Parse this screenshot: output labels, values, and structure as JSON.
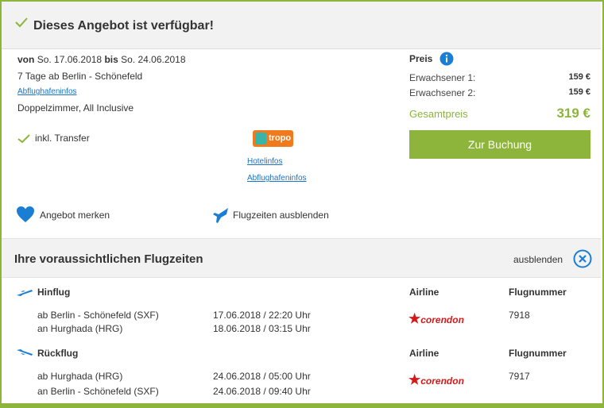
{
  "header": {
    "title": "Dieses Angebot ist verfügbar!"
  },
  "offer": {
    "von_label": "von",
    "date_from": "So. 17.06.2018",
    "bis_label": "bis",
    "date_to": "So. 24.06.2018",
    "duration": "7 Tage ab Berlin - Schönefeld",
    "airport_info_link": "Abflughafeninfos",
    "room": "Doppelzimmer, All Inclusive",
    "transfer": "inkl. Transfer",
    "provider_logo": "tropo",
    "hotel_info_link": "Hotelinfos",
    "airport_info_link_2": "Abflughafeninfos",
    "bookmark": "Angebot merken",
    "flight_toggle": "Flugzeiten ausblenden"
  },
  "price": {
    "label": "Preis",
    "adult1_label": "Erwachsener 1:",
    "adult1_value": "159 €",
    "adult2_label": "Erwachsener 2:",
    "adult2_value": "159 €",
    "total_label": "Gesamtpreis",
    "total_value": "319 €",
    "book_button": "Zur Buchung"
  },
  "flights": {
    "title": "Ihre voraussichtlichen Flugzeiten",
    "hide_label": "ausblenden",
    "outbound": {
      "label": "Hinflug",
      "airline_header": "Airline",
      "flightno_header": "Flugnummer",
      "dep_place": "ab Berlin - Schönefeld (SXF)",
      "dep_time": "17.06.2018 / 22:20 Uhr",
      "arr_place": "an Hurghada (HRG)",
      "arr_time": "18.06.2018 / 03:15 Uhr",
      "airline": "corendon",
      "flight_number": "7918"
    },
    "return": {
      "label": "Rückflug",
      "airline_header": "Airline",
      "flightno_header": "Flugnummer",
      "dep_place": "ab Hurghada (HRG)",
      "dep_time": "24.06.2018 / 05:00 Uhr",
      "arr_place": "an Berlin - Schönefeld (SXF)",
      "arr_time": "24.06.2018 / 09:40 Uhr",
      "airline": "corendon",
      "flight_number": "7917"
    }
  },
  "colors": {
    "accent": "#8db53c",
    "link": "#1a73c9",
    "icon_blue": "#1a7fd4",
    "corendon_red": "#d21a1a"
  }
}
